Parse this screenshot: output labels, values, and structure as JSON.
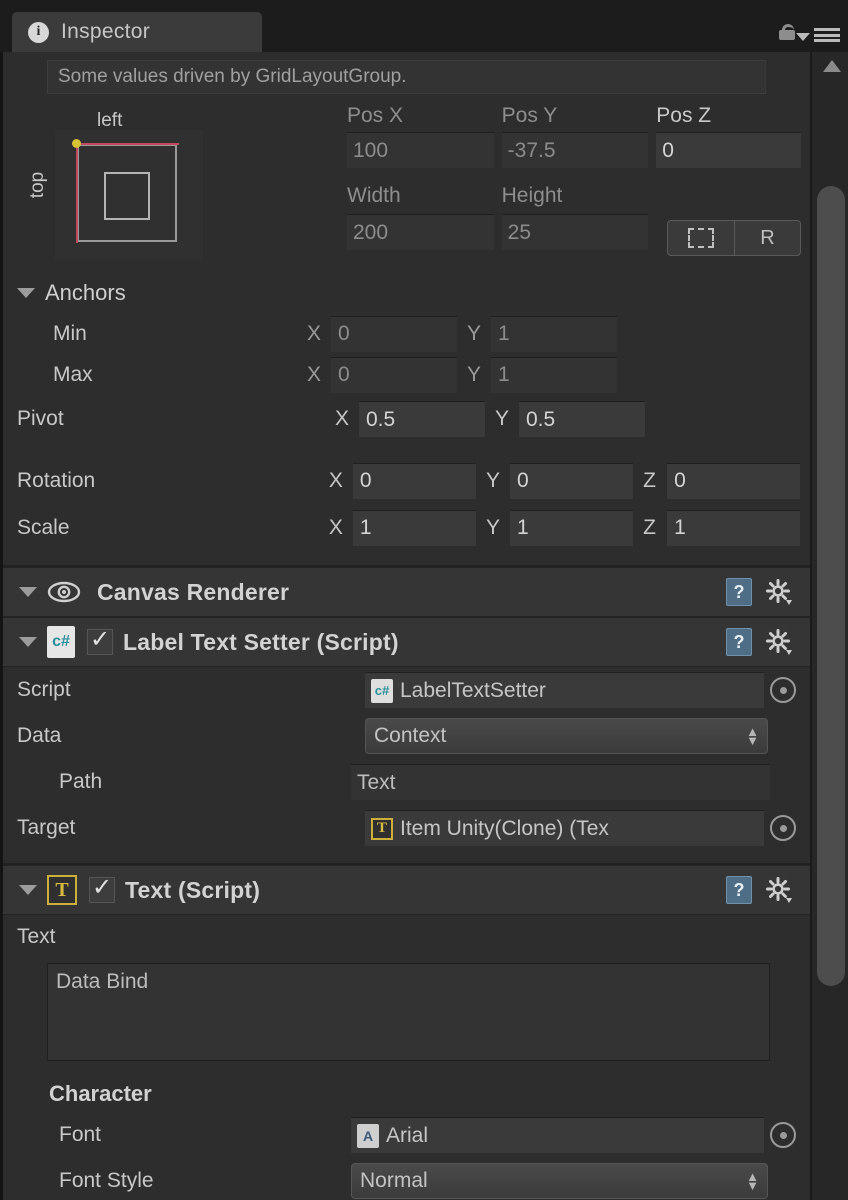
{
  "window": {
    "tab_label": "Inspector",
    "info_glyph": "i",
    "lock_icon": "lock-icon",
    "menu_icon": "hamburger-menu-icon"
  },
  "notice": {
    "text": "Some values driven by GridLayoutGroup."
  },
  "rect_transform": {
    "preview": {
      "anchor_label_horizontal": "left",
      "anchor_label_vertical": "top"
    },
    "headers": {
      "pos_x": "Pos X",
      "pos_y": "Pos Y",
      "pos_z": "Pos Z",
      "width": "Width",
      "height": "Height"
    },
    "values": {
      "pos_x": "100",
      "pos_y": "-37.5",
      "pos_z": "0",
      "width": "200",
      "height": "25"
    },
    "blueprint_button": "blueprint-mode-icon",
    "raw_button": "R",
    "anchors": {
      "title": "Anchors",
      "min_label": "Min",
      "max_label": "Max",
      "pivot_label": "Pivot",
      "min": {
        "x_label": "X",
        "x": "0",
        "y_label": "Y",
        "y": "1"
      },
      "max": {
        "x_label": "X",
        "x": "0",
        "y_label": "Y",
        "y": "1"
      },
      "pivot": {
        "x_label": "X",
        "x": "0.5",
        "y_label": "Y",
        "y": "0.5"
      }
    },
    "rotation": {
      "label": "Rotation",
      "x_label": "X",
      "x": "0",
      "y_label": "Y",
      "y": "0",
      "z_label": "Z",
      "z": "0"
    },
    "scale": {
      "label": "Scale",
      "x_label": "X",
      "x": "1",
      "y_label": "Y",
      "y": "1",
      "z_label": "Z",
      "z": "1"
    }
  },
  "components": [
    {
      "title": "Canvas Renderer",
      "icon": "eye-icon",
      "help": "?",
      "gear": "gear-icon"
    },
    {
      "title": "Label Text Setter (Script)",
      "icon": "csharp-script-icon",
      "enabled": true,
      "help": "?",
      "gear": "gear-icon"
    },
    {
      "title": "Text (Script)",
      "icon": "text-component-icon",
      "enabled": true,
      "help": "?",
      "gear": "gear-icon"
    }
  ],
  "label_text_setter": {
    "script": {
      "label": "Script",
      "value": "LabelTextSetter",
      "icon": "csharp-script-icon"
    },
    "data": {
      "label": "Data",
      "value": "Context",
      "options": [
        "Context"
      ]
    },
    "path": {
      "label": "Path",
      "value": "Text"
    },
    "target": {
      "label": "Target",
      "value": "Item Unity(Clone) (Tex",
      "icon": "text-component-icon"
    }
  },
  "text_component": {
    "text_label": "Text",
    "text_value": "Data Bind",
    "character_section": "Character",
    "font": {
      "label": "Font",
      "value": "Arial",
      "icon": "font-asset-icon"
    },
    "font_style": {
      "label": "Font Style",
      "value": "Normal",
      "options": [
        "Normal"
      ]
    }
  },
  "colors": {
    "panel_bg": "#2d2d2d",
    "header_bg": "#353535",
    "field_bg": "#333333",
    "accent_red": "#c0495e",
    "accent_yellow": "#d8c337",
    "text_primary": "#c8c8c8",
    "text_dim": "#8c8c8c"
  }
}
